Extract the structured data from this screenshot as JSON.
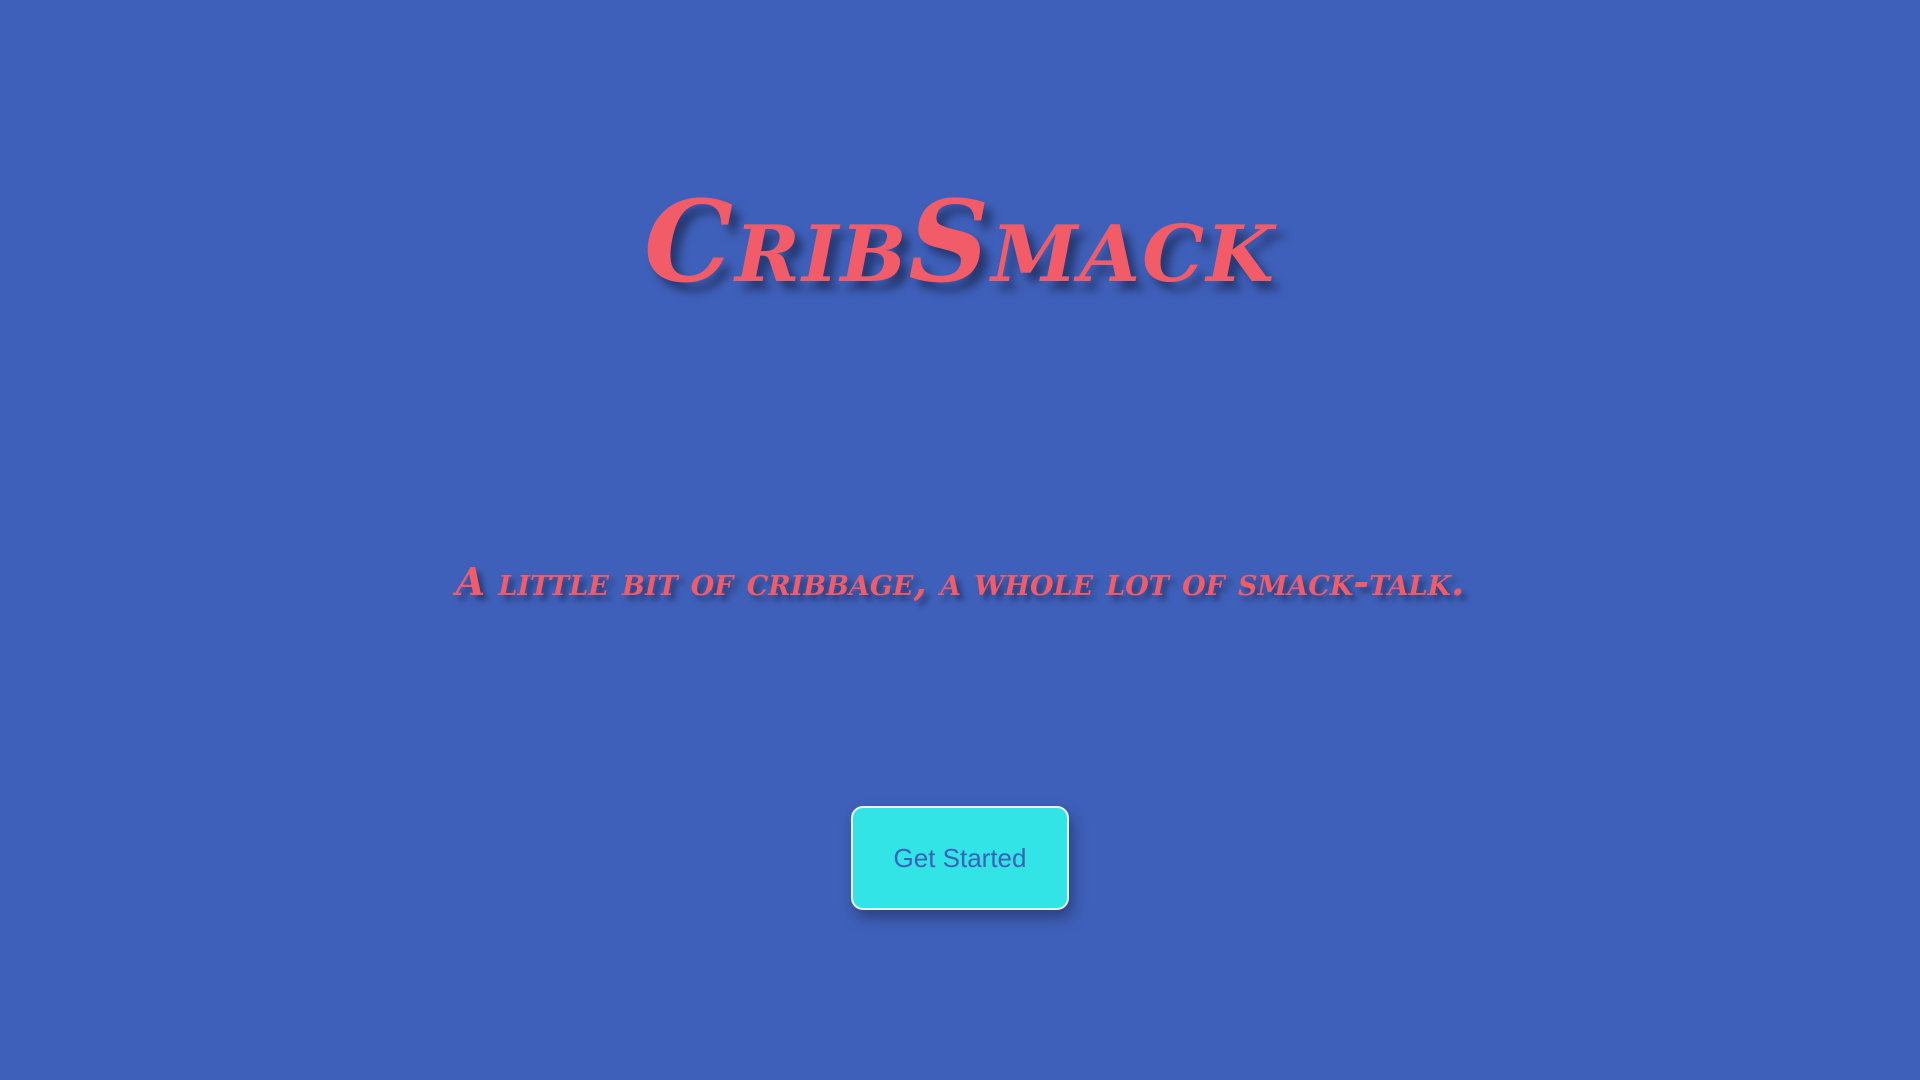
{
  "app": {
    "title": "CribSmack",
    "tagline": "A little bit of cribbage, a whole lot of smack-talk."
  },
  "actions": {
    "get_started_label": "Get Started"
  },
  "colors": {
    "background": "#3f60ba",
    "accent": "#f25b68",
    "button_background": "#33e4e6",
    "button_text": "#3b62b8"
  }
}
